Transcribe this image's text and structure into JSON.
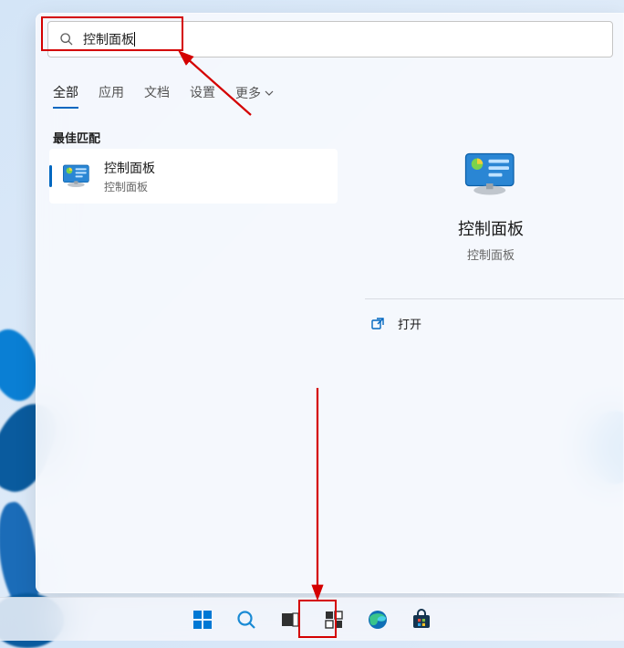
{
  "search": {
    "query": "控制面板",
    "placeholder": ""
  },
  "tabs": {
    "items": [
      {
        "label": "全部",
        "active": true
      },
      {
        "label": "应用",
        "active": false
      },
      {
        "label": "文档",
        "active": false
      },
      {
        "label": "设置",
        "active": false
      },
      {
        "label": "更多",
        "active": false
      }
    ]
  },
  "section": {
    "best_match": "最佳匹配"
  },
  "result": {
    "title": "控制面板",
    "subtitle": "控制面板"
  },
  "preview": {
    "title": "控制面板",
    "subtitle": "控制面板"
  },
  "actions": {
    "open": "打开"
  },
  "taskbar": {
    "items": [
      "start",
      "search",
      "taskview",
      "widgets",
      "edge",
      "store"
    ]
  },
  "icons": {
    "control_panel": "control-panel-icon",
    "search": "search-icon",
    "open_external": "open-icon",
    "chevron_down": "chevron-down-icon"
  },
  "colors": {
    "accent": "#0067c0",
    "highlight": "#d40000"
  }
}
